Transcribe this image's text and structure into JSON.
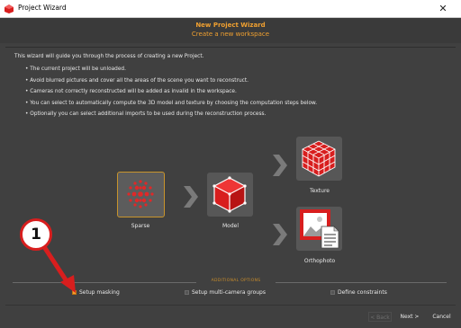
{
  "window": {
    "title": "Project Wizard",
    "minimize": "—",
    "maximize": "☐",
    "close": "✕"
  },
  "header": {
    "title": "New Project Wizard",
    "subtitle": "Create a new workspace"
  },
  "intro": "This wizard will guide you through the process of creating a new Project.",
  "bullets": [
    "• The current project will be unloaded.",
    "• Avoid blurred pictures and cover all the areas of the scene you want to reconstruct.",
    "• Cameras not correctly reconstructed will be added as invalid in the workspace.",
    "• You can select to automatically compute the 3D model and texture by choosing the computation steps below.",
    "• Optionally you can select additional imports to be used during the reconstruction process."
  ],
  "steps": {
    "sparse": {
      "label": "Sparse",
      "icon": "sparse-points-icon",
      "selected": true
    },
    "model": {
      "label": "Model",
      "icon": "cube-mesh-icon",
      "selected": false
    },
    "texture": {
      "label": "Texture",
      "icon": "textured-cube-icon",
      "selected": false
    },
    "ortho": {
      "label": "Orthophoto",
      "icon": "orthophoto-icon",
      "selected": false
    }
  },
  "additional": {
    "title": "ADDITIONAL OPTIONS",
    "options": [
      {
        "label": "Setup masking",
        "checked": true
      },
      {
        "label": "Setup multi-camera groups",
        "checked": false
      },
      {
        "label": "Define constraints",
        "checked": false
      }
    ]
  },
  "buttons": {
    "back": "< Back",
    "next": "Next >",
    "cancel": "Cancel"
  },
  "callout": {
    "number": "1"
  },
  "colors": {
    "accent": "#f0a030",
    "red": "#d81e1e",
    "panel": "#575757",
    "background": "#404040"
  }
}
